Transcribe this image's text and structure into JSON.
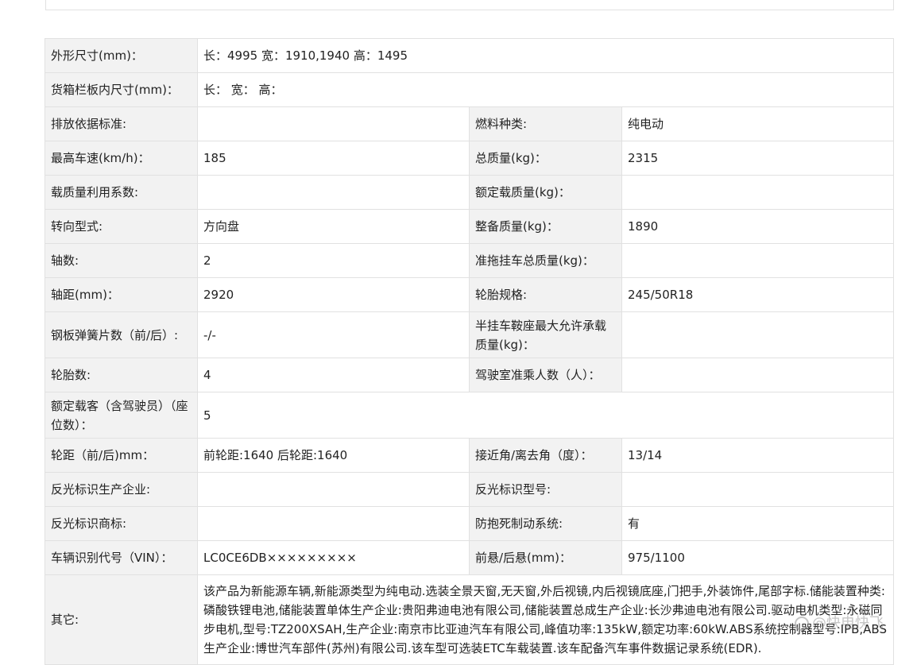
{
  "rows": [
    {
      "label": "外形尺寸(mm)：",
      "value": "长：4995 宽：1910,1940 高：1495",
      "full": true
    },
    {
      "label": "货箱栏板内尺寸(mm)：",
      "value": "长：  宽：  高：",
      "full": true
    },
    {
      "label": "排放依据标准:",
      "value": "",
      "label2": "燃料种类:",
      "value2": "纯电动"
    },
    {
      "label": "最高车速(km/h)：",
      "value": "185",
      "label2": "总质量(kg)：",
      "value2": "2315"
    },
    {
      "label": "载质量利用系数:",
      "value": "",
      "label2": "额定载质量(kg)：",
      "value2": ""
    },
    {
      "label": "转向型式:",
      "value": "方向盘",
      "label2": "整备质量(kg)：",
      "value2": "1890"
    },
    {
      "label": "轴数:",
      "value": "2",
      "label2": "准拖挂车总质量(kg)：",
      "value2": ""
    },
    {
      "label": "轴距(mm)：",
      "value": "2920",
      "label2": "轮胎规格:",
      "value2": "245/50R18"
    },
    {
      "label": "钢板弹簧片数（前/后）:",
      "value": "-/-",
      "label2": "半挂车鞍座最大允许承载质量(kg)：",
      "value2": ""
    },
    {
      "label": "轮胎数:",
      "value": "4",
      "label2": "驾驶室准乘人数（人）：",
      "value2": ""
    },
    {
      "label": "额定载客（含驾驶员）（座位数）：",
      "value": "5",
      "full": true
    },
    {
      "label": "轮距（前/后)mm：",
      "value": "前轮距:1640 后轮距:1640",
      "label2": "接近角/离去角（度）：",
      "value2": "13/14"
    },
    {
      "label": "反光标识生产企业:",
      "value": "",
      "label2": "反光标识型号:",
      "value2": ""
    },
    {
      "label": "反光标识商标:",
      "value": "",
      "label2": "防抱死制动系统:",
      "value2": "有"
    },
    {
      "label": "车辆识别代号（VIN）：",
      "value": "LC0CE6DB×××××××××",
      "label2": "前悬/后悬(mm)：",
      "value2": "975/1100"
    }
  ],
  "other": {
    "label": "其它:",
    "value": "该产品为新能源车辆,新能源类型为纯电动.选装全景天窗,无天窗,外后视镜,内后视镜底座,门把手,外装饰件,尾部字标.储能装置种类:磷酸铁锂电池,储能装置单体生产企业:贵阳弗迪电池有限公司,储能装置总成生产企业:长沙弗迪电池有限公司.驱动电机类型:永磁同步电机,型号:TZ200XSAH,生产企业:南京市比亚迪汽车有限公司,峰值功率:135kW,额定功率:60kW.ABS系统控制器型号:IPB,ABS生产企业:博世汽车部件(苏州)有限公司.该车型可选装ETC车载装置.该车配备汽车事件数据记录系统(EDR)."
  },
  "watermark": "@快电快飞"
}
